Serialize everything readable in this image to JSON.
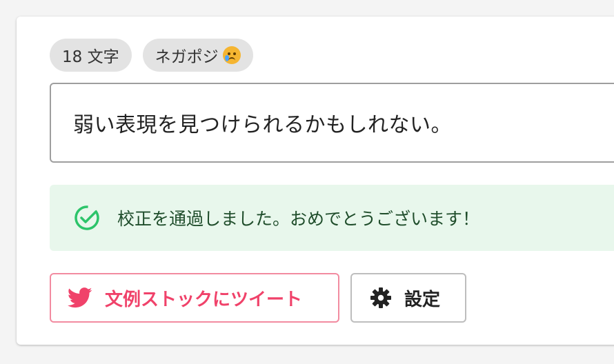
{
  "tags": {
    "char_count": "18 文字",
    "sentiment_label": "ネガポジ",
    "sentiment_icon": "crying-face-icon"
  },
  "editor": {
    "value": "弱い表現を見つけられるかもしれない。"
  },
  "result": {
    "message": "校正を通過しました。おめでとうございます！",
    "status_icon": "check-circle-icon"
  },
  "actions": {
    "tweet_label": "文例ストックにツイート",
    "settings_label": "設定"
  },
  "colors": {
    "tweet_accent": "#f0426a",
    "success_bg": "#e8f7ec",
    "success_icon": "#2cc46a"
  }
}
